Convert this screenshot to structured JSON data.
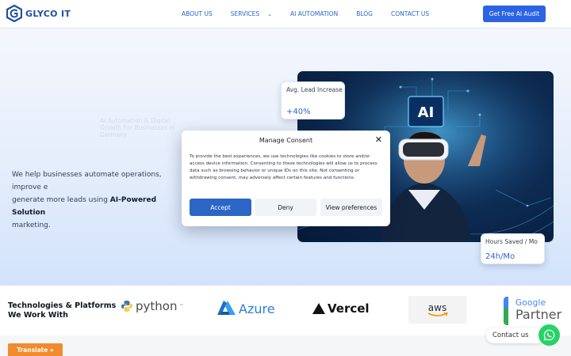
{
  "header": {
    "logo_text": "GLYCO IT",
    "nav": [
      {
        "label": "ABOUT US"
      },
      {
        "label": "SERVICES",
        "has_dropdown": true
      },
      {
        "label": "AI AUTOMATION"
      },
      {
        "label": "BLOG"
      },
      {
        "label": "CONTACT US"
      }
    ],
    "cta_label": "Get Free AI Audit"
  },
  "hero": {
    "faded_heading": "AI Automation & Digital Growth For Businesses in Germany",
    "desc_prefix": "We help businesses automate operations, improve e",
    "desc_middle": "generate more leads using ",
    "desc_bold": "AI-Powered Solution",
    "desc_suffix": "marketing.",
    "image_badge": "AI",
    "stat1": {
      "label": "Avg. Lead Increase",
      "value": "+40%"
    },
    "stat2": {
      "label": "Hours Saved / Mo",
      "value": "24h/Mo"
    }
  },
  "consent": {
    "title": "Manage Consent",
    "text": "To provide the best experiences, we use technologies like cookies to store and/or access device information. Consenting to these technologies will allow us to process data such as browsing behavior or unique IDs on this site. Not consenting or withdrawing consent, may adversely affect certain features and functions.",
    "accept_label": "Accept",
    "deny_label": "Deny",
    "prefs_label": "View preferences"
  },
  "tech": {
    "title_line1": "Technologies & Platforms",
    "title_line2": "We Work With",
    "brands": {
      "python": "python",
      "python_tm": "™",
      "azure": "Azure",
      "vercel": "Vercel",
      "aws": "aws",
      "google": "Google",
      "partner": "Partner"
    }
  },
  "widgets": {
    "translate_label": "Translate »",
    "contact_label": "Contact us"
  },
  "colors": {
    "primary": "#2a63e3",
    "accent_orange": "#f08c2e",
    "whatsapp": "#25d366"
  }
}
